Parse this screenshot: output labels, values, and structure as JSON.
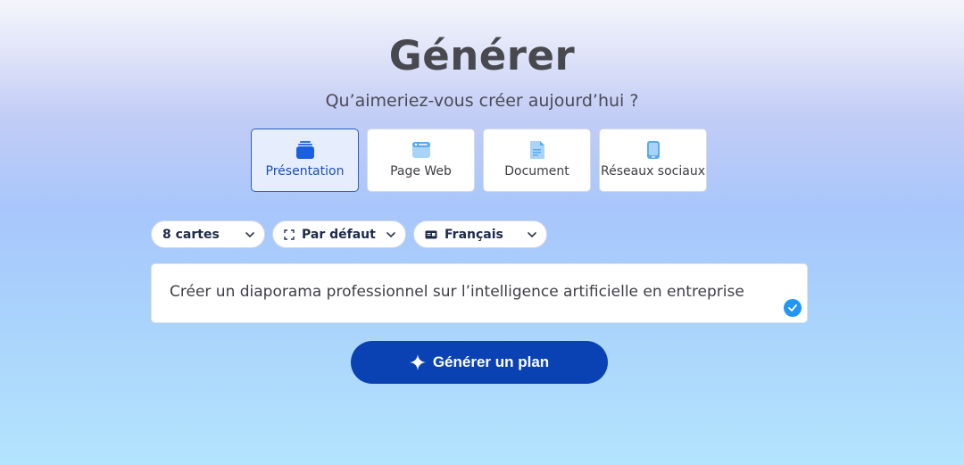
{
  "header": {
    "title": "Générer",
    "subtitle": "Qu’aimeriez-vous créer aujourd’hui ?"
  },
  "types": [
    {
      "label": "Présentation",
      "icon": "stack-cards-icon",
      "selected": true
    },
    {
      "label": "Page Web",
      "icon": "browser-window-icon",
      "selected": false
    },
    {
      "label": "Document",
      "icon": "document-icon",
      "selected": false
    },
    {
      "label": "Réseaux sociaux",
      "icon": "phone-icon",
      "selected": false
    }
  ],
  "options": {
    "cards": "8 cartes",
    "format": "Par défaut",
    "language": "Français"
  },
  "prompt": {
    "value": "Créer un diaporama professionnel sur l’intelligence artificielle en entreprise"
  },
  "generate_button": {
    "label": "Générer un plan"
  },
  "colors": {
    "accent": "#0a42b4",
    "selected_bg": "#e6eefd",
    "icon_blue": "#2f6fe0",
    "check": "#2196f3"
  }
}
